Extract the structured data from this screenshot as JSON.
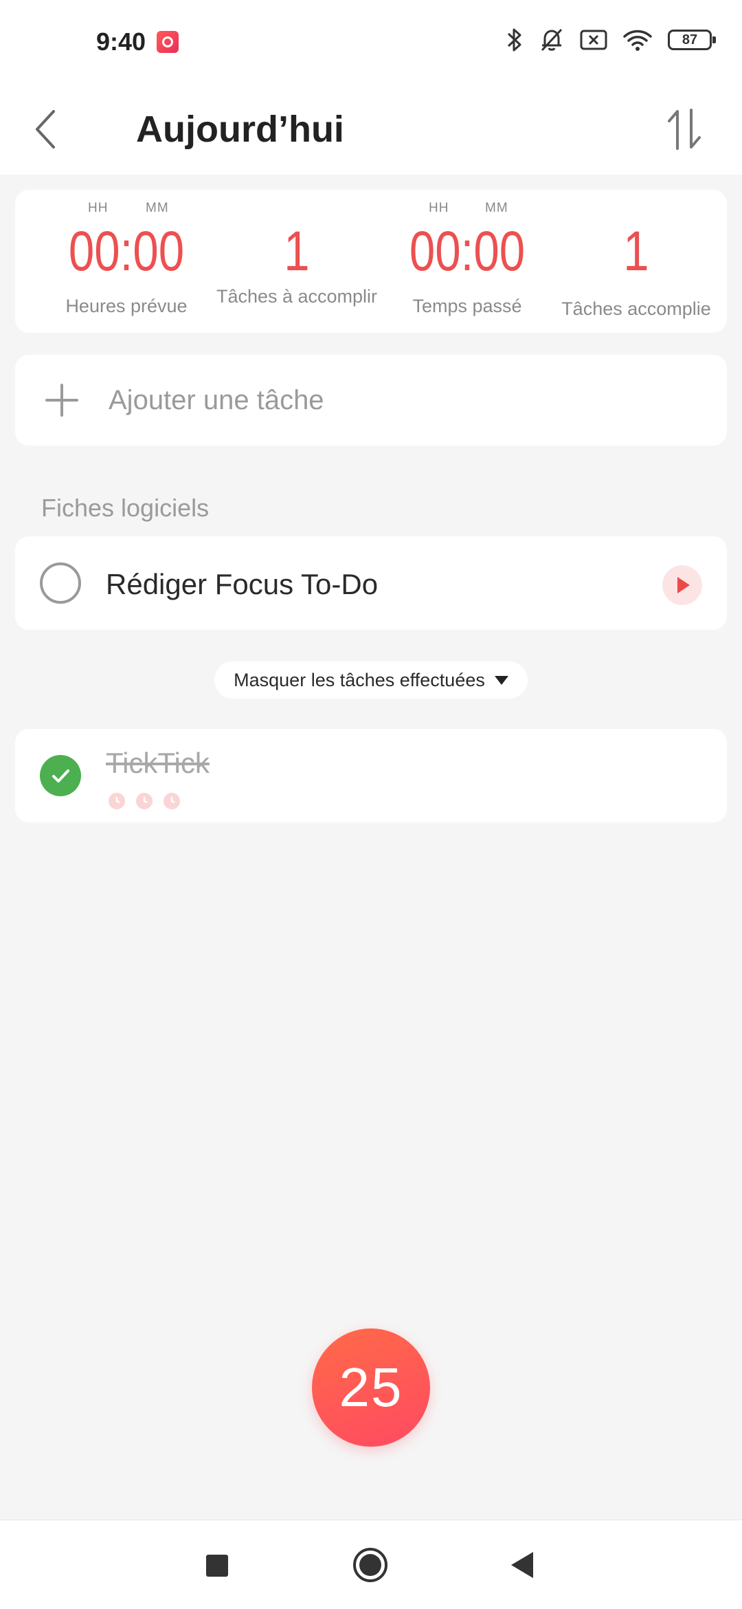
{
  "status_bar": {
    "time": "9:40",
    "battery": "87",
    "icons": [
      "bluetooth-icon",
      "muted-bell-icon",
      "no-sim-icon",
      "wifi-icon",
      "battery-icon"
    ]
  },
  "header": {
    "title": "Aujourd’hui",
    "back_icon": "chevron-left-icon",
    "sort_icon": "sort-arrows-icon"
  },
  "summary": {
    "hh": "HH",
    "mm": "MM",
    "stats": [
      {
        "value": "00:00",
        "label": "Heures prévue"
      },
      {
        "value": "1",
        "label": "Tâches à accomplir"
      },
      {
        "value": "00:00",
        "label": "Temps passé"
      },
      {
        "value": "1",
        "label": "Tâches accomplie"
      }
    ]
  },
  "add_task": {
    "placeholder": "Ajouter une tâche"
  },
  "section": {
    "title": "Fiches logiciels",
    "tasks": [
      {
        "title": "Rédiger Focus To-Do",
        "done": false
      }
    ]
  },
  "toggle_done_label": "Masquer les tâches effectuées",
  "done_tasks": [
    {
      "title": "TickTick",
      "pomodoros_completed": 3
    }
  ],
  "timer": {
    "minutes": "25"
  },
  "colors": {
    "accent": "#ec5050",
    "done_green": "#4caf50",
    "timer_gradient_start": "#ff6a48",
    "timer_gradient_end": "#ff4a62"
  }
}
